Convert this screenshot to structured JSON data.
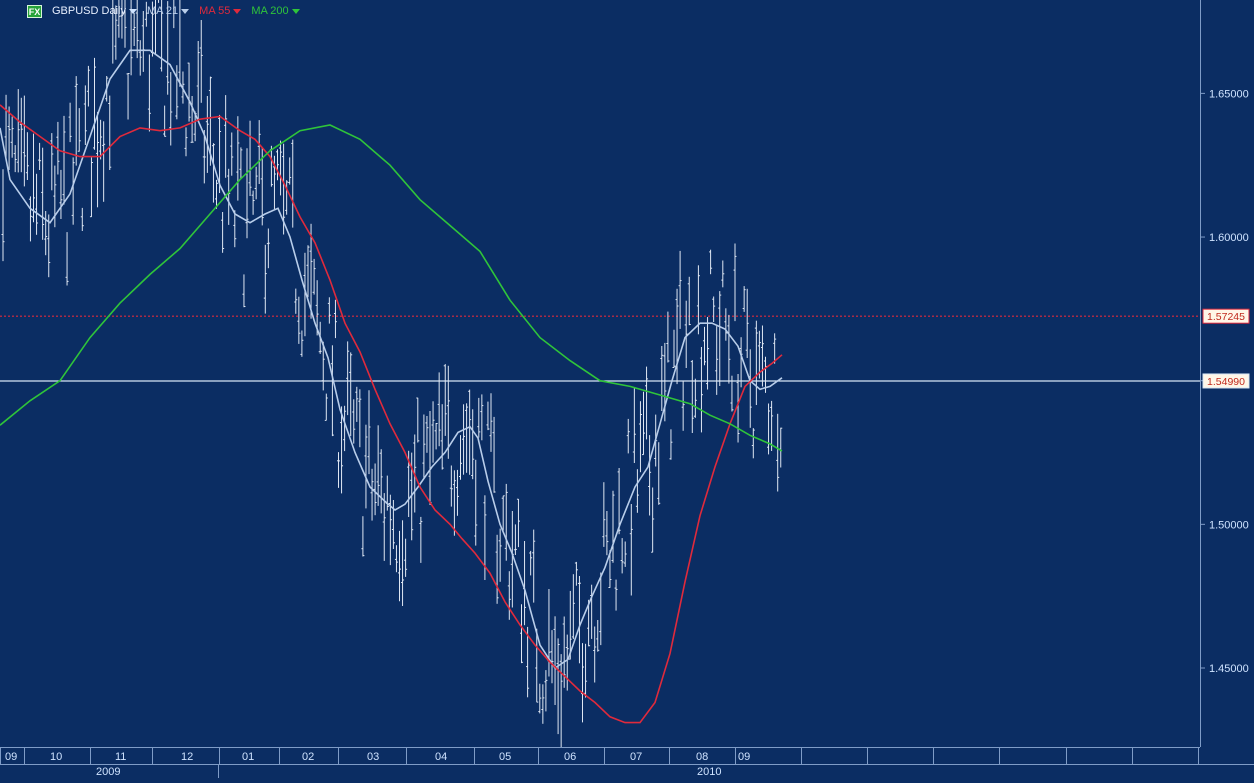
{
  "legend": {
    "badge": "FX",
    "instrument": "GBPUSD Daily",
    "items": [
      {
        "label": "MA 21",
        "color": "#b8cdea"
      },
      {
        "label": "MA 55",
        "color": "#e02a3c"
      },
      {
        "label": "MA 200",
        "color": "#2fc43a"
      }
    ]
  },
  "colors": {
    "background": "#0b2d63",
    "bars": "#dfe7f3",
    "grid": "#1f4a86",
    "axis_text": "#cfe3ff",
    "ma21": "#b8cdea",
    "ma55": "#e02a3c",
    "ma200": "#2fc43a",
    "ref_dotted": "#e02a3c",
    "ref_solid": "#d7e5f5"
  },
  "chart_data": {
    "type": "ohlc",
    "title": "GBPUSD Daily",
    "x_axis": {
      "month_labels": [
        "09",
        "10",
        "11",
        "12",
        "01",
        "02",
        "03",
        "04",
        "05",
        "06",
        "07",
        "08",
        "09"
      ],
      "year_labels": [
        "2009",
        "2010"
      ]
    },
    "y_axis": {
      "range": [
        1.4225,
        1.6825
      ],
      "ticks": [
        "1.45000",
        "1.50000",
        "1.55000",
        "1.60000",
        "1.65000"
      ]
    },
    "reference_lines": [
      {
        "label": "1.57245",
        "value": 1.57245,
        "style": "dotted",
        "color": "#e02a3c"
      },
      {
        "label": "1.54990",
        "value": 1.5499,
        "style": "solid",
        "color": "#d7e5f5"
      }
    ],
    "series": [
      {
        "name": "MA 21",
        "color": "#b8cdea",
        "points": [
          [
            0,
            1.638
          ],
          [
            10,
            1.62
          ],
          [
            30,
            1.61
          ],
          [
            50,
            1.605
          ],
          [
            70,
            1.615
          ],
          [
            90,
            1.635
          ],
          [
            110,
            1.655
          ],
          [
            130,
            1.665
          ],
          [
            150,
            1.665
          ],
          [
            170,
            1.66
          ],
          [
            190,
            1.647
          ],
          [
            205,
            1.635
          ],
          [
            220,
            1.618
          ],
          [
            235,
            1.608
          ],
          [
            250,
            1.605
          ],
          [
            265,
            1.608
          ],
          [
            278,
            1.61
          ],
          [
            290,
            1.6
          ],
          [
            302,
            1.585
          ],
          [
            315,
            1.57
          ],
          [
            328,
            1.558
          ],
          [
            340,
            1.54
          ],
          [
            355,
            1.525
          ],
          [
            370,
            1.513
          ],
          [
            385,
            1.508
          ],
          [
            395,
            1.505
          ],
          [
            405,
            1.507
          ],
          [
            418,
            1.513
          ],
          [
            432,
            1.52
          ],
          [
            445,
            1.525
          ],
          [
            458,
            1.532
          ],
          [
            470,
            1.534
          ],
          [
            478,
            1.53
          ],
          [
            488,
            1.515
          ],
          [
            500,
            1.5
          ],
          [
            512,
            1.49
          ],
          [
            525,
            1.477
          ],
          [
            540,
            1.458
          ],
          [
            555,
            1.45
          ],
          [
            568,
            1.453
          ],
          [
            580,
            1.465
          ],
          [
            592,
            1.475
          ],
          [
            605,
            1.485
          ],
          [
            620,
            1.5
          ],
          [
            635,
            1.513
          ],
          [
            648,
            1.52
          ],
          [
            660,
            1.535
          ],
          [
            672,
            1.55
          ],
          [
            685,
            1.565
          ],
          [
            700,
            1.57
          ],
          [
            712,
            1.57
          ],
          [
            725,
            1.568
          ],
          [
            738,
            1.562
          ],
          [
            750,
            1.55
          ],
          [
            760,
            1.547
          ],
          [
            770,
            1.548
          ],
          [
            782,
            1.551
          ]
        ]
      },
      {
        "name": "MA 55",
        "color": "#e02a3c",
        "points": [
          [
            0,
            1.646
          ],
          [
            20,
            1.64
          ],
          [
            40,
            1.635
          ],
          [
            60,
            1.63
          ],
          [
            80,
            1.628
          ],
          [
            100,
            1.628
          ],
          [
            120,
            1.635
          ],
          [
            140,
            1.638
          ],
          [
            160,
            1.637
          ],
          [
            180,
            1.638
          ],
          [
            200,
            1.641
          ],
          [
            220,
            1.642
          ],
          [
            240,
            1.637
          ],
          [
            255,
            1.634
          ],
          [
            270,
            1.628
          ],
          [
            285,
            1.618
          ],
          [
            300,
            1.607
          ],
          [
            315,
            1.598
          ],
          [
            330,
            1.585
          ],
          [
            345,
            1.57
          ],
          [
            360,
            1.56
          ],
          [
            375,
            1.547
          ],
          [
            390,
            1.535
          ],
          [
            405,
            1.525
          ],
          [
            420,
            1.513
          ],
          [
            435,
            1.505
          ],
          [
            450,
            1.5
          ],
          [
            462,
            1.495
          ],
          [
            475,
            1.49
          ],
          [
            490,
            1.483
          ],
          [
            505,
            1.473
          ],
          [
            520,
            1.465
          ],
          [
            535,
            1.458
          ],
          [
            550,
            1.452
          ],
          [
            565,
            1.447
          ],
          [
            580,
            1.442
          ],
          [
            595,
            1.438
          ],
          [
            610,
            1.433
          ],
          [
            625,
            1.431
          ],
          [
            640,
            1.431
          ],
          [
            655,
            1.438
          ],
          [
            670,
            1.455
          ],
          [
            685,
            1.48
          ],
          [
            700,
            1.503
          ],
          [
            715,
            1.52
          ],
          [
            730,
            1.535
          ],
          [
            745,
            1.548
          ],
          [
            760,
            1.553
          ],
          [
            772,
            1.556
          ],
          [
            782,
            1.559
          ]
        ]
      },
      {
        "name": "MA 200",
        "color": "#2fc43a",
        "points": [
          [
            0,
            1.5345
          ],
          [
            30,
            1.543
          ],
          [
            60,
            1.55
          ],
          [
            90,
            1.565
          ],
          [
            120,
            1.577
          ],
          [
            150,
            1.587
          ],
          [
            180,
            1.596
          ],
          [
            210,
            1.608
          ],
          [
            240,
            1.62
          ],
          [
            270,
            1.63
          ],
          [
            300,
            1.637
          ],
          [
            330,
            1.639
          ],
          [
            360,
            1.634
          ],
          [
            390,
            1.625
          ],
          [
            420,
            1.613
          ],
          [
            450,
            1.604
          ],
          [
            480,
            1.595
          ],
          [
            510,
            1.578
          ],
          [
            540,
            1.565
          ],
          [
            570,
            1.557
          ],
          [
            600,
            1.55
          ],
          [
            630,
            1.548
          ],
          [
            660,
            1.545
          ],
          [
            690,
            1.542
          ],
          [
            710,
            1.538
          ],
          [
            730,
            1.535
          ],
          [
            750,
            1.531
          ],
          [
            770,
            1.528
          ],
          [
            782,
            1.5255
          ]
        ]
      }
    ]
  }
}
